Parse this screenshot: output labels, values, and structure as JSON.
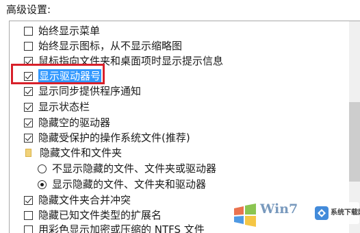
{
  "section_title": "高级设置:",
  "options": [
    {
      "type": "checkbox",
      "checked": false,
      "label": "始终显示菜单"
    },
    {
      "type": "checkbox",
      "checked": false,
      "label": "始终显示图标，从不显示缩略图"
    },
    {
      "type": "checkbox",
      "checked": true,
      "label": "鼠标指向文件夹和桌面项时显示提示信息"
    },
    {
      "type": "checkbox",
      "checked": true,
      "label": "显示驱动器号",
      "selected": true
    },
    {
      "type": "checkbox",
      "checked": true,
      "label": "显示同步提供程序通知"
    },
    {
      "type": "checkbox",
      "checked": true,
      "label": "显示状态栏"
    },
    {
      "type": "checkbox",
      "checked": true,
      "label": "隐藏空的驱动器"
    },
    {
      "type": "checkbox",
      "checked": true,
      "label": "隐藏受保护的操作系统文件(推荐)"
    },
    {
      "type": "folder",
      "label": "隐藏文件和文件夹"
    },
    {
      "type": "radio",
      "checked": false,
      "label": "不显示隐藏的文件、文件夹或驱动器"
    },
    {
      "type": "radio",
      "checked": true,
      "label": "显示隐藏的文件、文件夹和驱动器"
    },
    {
      "type": "checkbox",
      "checked": true,
      "label": "隐藏文件夹合并冲突"
    },
    {
      "type": "checkbox",
      "checked": false,
      "label": "隐藏已知文件类型的扩展名"
    },
    {
      "type": "checkbox",
      "checked": false,
      "label": "用彩色显示加密或压缩的 NTFS 文件"
    }
  ],
  "watermark": {
    "text": "Win7",
    "badge_label": "系统下载网"
  },
  "colors": {
    "selection": "#3399ff",
    "highlight_border": "#d8202a"
  }
}
